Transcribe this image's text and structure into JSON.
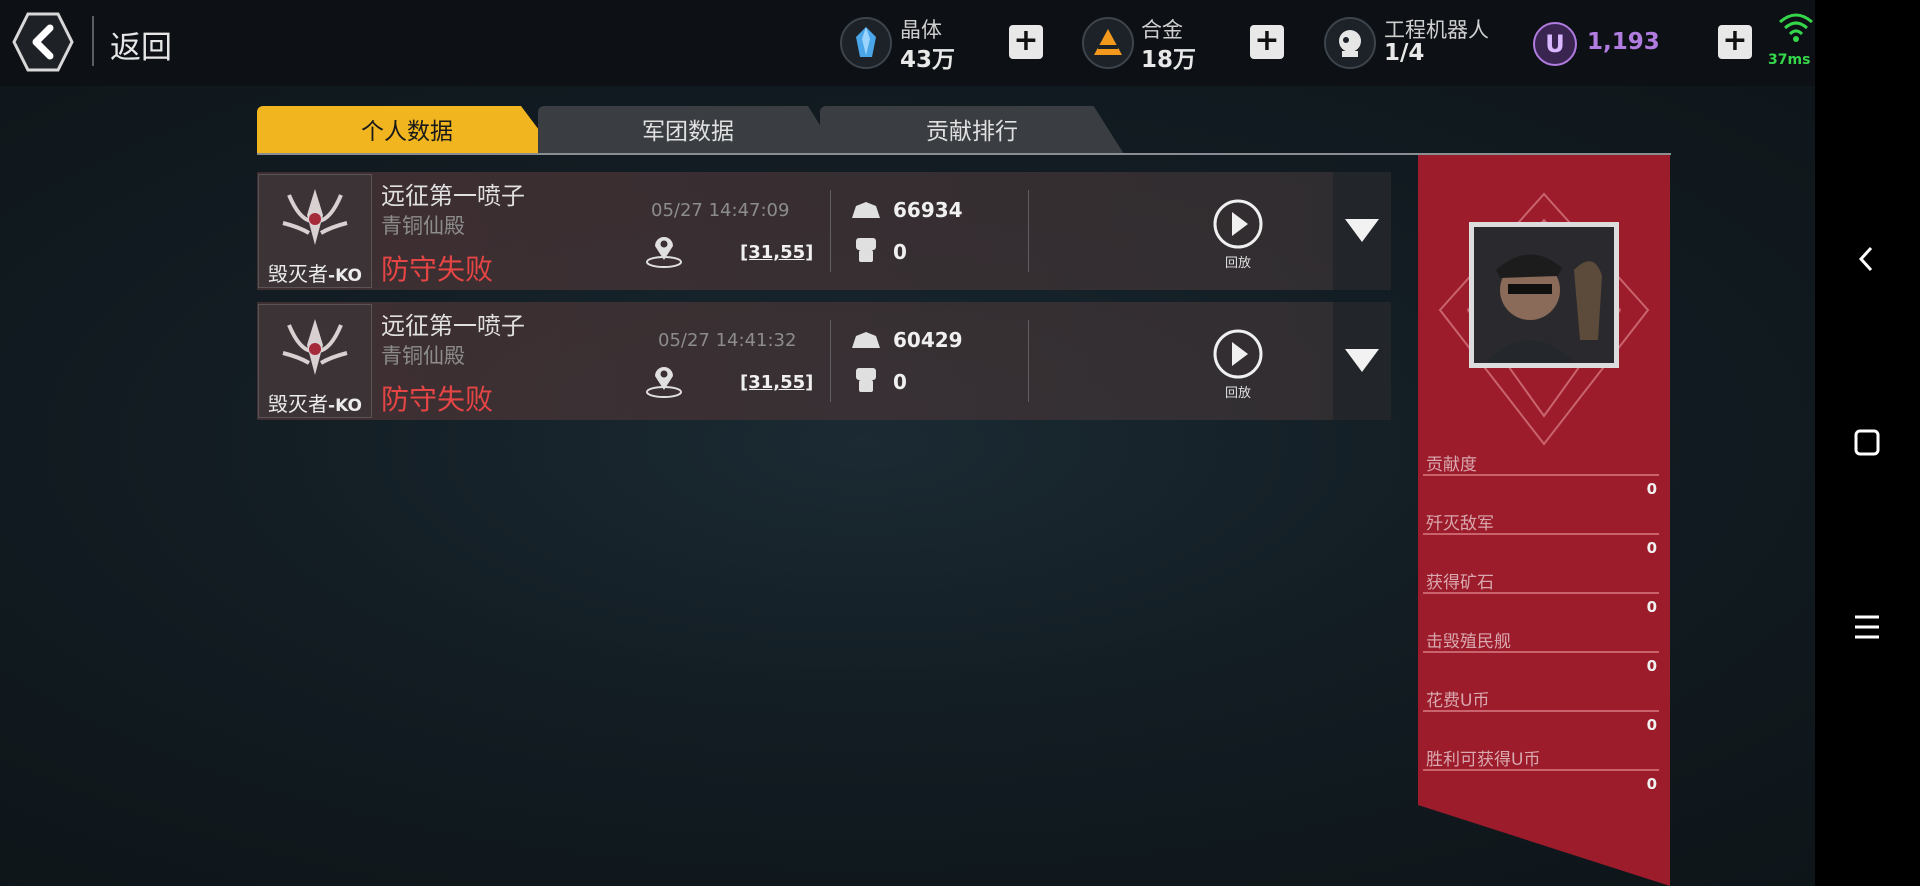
{
  "header": {
    "back_label": "返回",
    "resources": [
      {
        "name": "晶体",
        "value": "43万",
        "icon": "crystal-icon"
      },
      {
        "name": "合金",
        "value": "18万",
        "icon": "alloy-icon"
      },
      {
        "name": "工程机器人",
        "value": "1/4",
        "icon": "robot-icon"
      }
    ],
    "ucoin": {
      "value": "1,193",
      "icon": "u-coin-icon"
    },
    "ping": "37ms",
    "cart_badge": "!"
  },
  "tabs": [
    {
      "label": "个人数据",
      "active": true
    },
    {
      "label": "军团数据",
      "active": false
    },
    {
      "label": "贡献排行",
      "active": false
    }
  ],
  "records": [
    {
      "badge": "毁灭者",
      "badge_ko": "-KO",
      "title": "远征第一喷子",
      "subtitle": "青铜仙殿",
      "result": "防守失败",
      "time": "05/27 14:47:09",
      "coord": "[31,55]",
      "power": "66934",
      "fist": "0",
      "replay_label": "回放"
    },
    {
      "badge": "毁灭者",
      "badge_ko": "-KO",
      "title": "远征第一喷子",
      "subtitle": "青铜仙殿",
      "result": "防守失败",
      "time": "05/27 14:41:32",
      "coord": "[31,55]",
      "power": "60429",
      "fist": "0",
      "replay_label": "回放"
    }
  ],
  "stats": [
    {
      "label": "贡献度",
      "value": "0"
    },
    {
      "label": "歼灭敌军",
      "value": "0"
    },
    {
      "label": "获得矿石",
      "value": "0"
    },
    {
      "label": "击毁殖民舰",
      "value": "0"
    },
    {
      "label": "花费U币",
      "value": "0"
    },
    {
      "label": "胜利可获得U币",
      "value": "0"
    }
  ],
  "colors": {
    "active_tab": "#f1b520",
    "panel": "#9c1c2c",
    "defeat": "#e64545",
    "ucoin": "#b07ce0",
    "ping": "#35d64a"
  }
}
